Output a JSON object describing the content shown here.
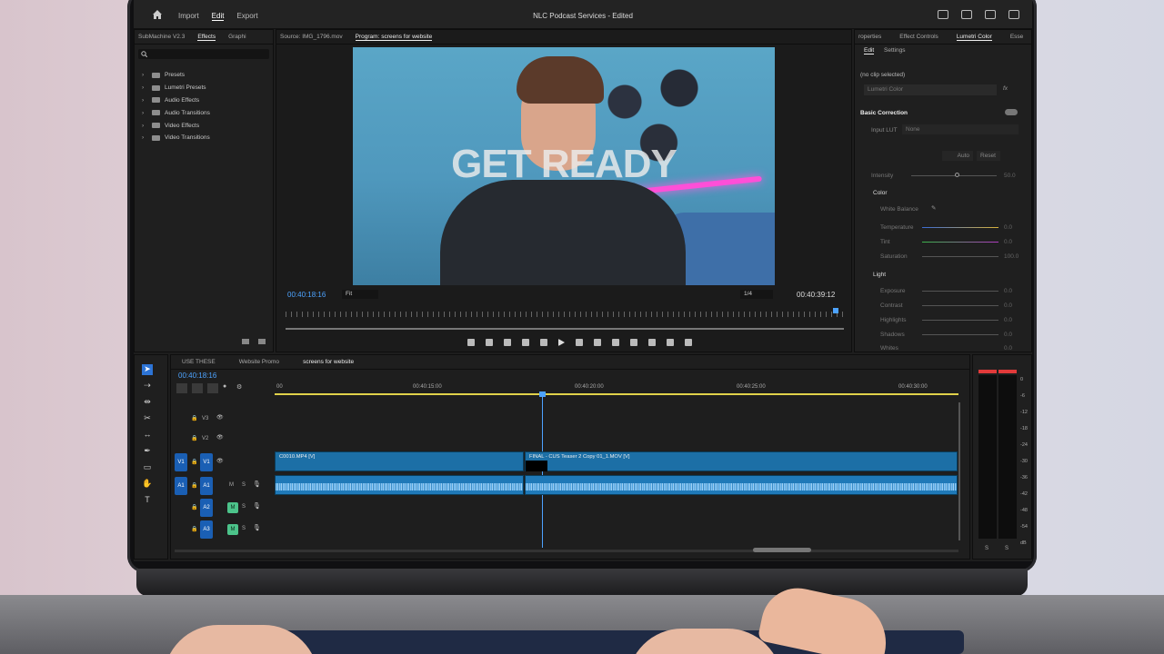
{
  "app": {
    "title": "NLC Podcast Services - Edited",
    "menu": [
      "Import",
      "Edit",
      "Export"
    ],
    "active_menu": "Edit"
  },
  "effects_panel": {
    "tabs": [
      "SubMachine V2.3",
      "Effects",
      "Graphi"
    ],
    "active_tab": "Effects",
    "items": [
      "Presets",
      "Lumetri Presets",
      "Audio Effects",
      "Audio Transitions",
      "Video Effects",
      "Video Transitions"
    ]
  },
  "monitor": {
    "tabs": [
      "Source: IMG_1796.mov",
      "Program: screens for website"
    ],
    "active_tab": "Program: screens for website",
    "overlay_text": "GET READY",
    "timecode_left": "00:40:18:16",
    "timecode_right": "00:40:39:12",
    "fit": "Fit",
    "resolution": "1/4"
  },
  "lumetri": {
    "tabs": [
      "roperties",
      "Effect Controls",
      "Lumetri Color",
      "Esse"
    ],
    "active_tab": "Lumetri Color",
    "subtabs": [
      "Edit",
      "Settings"
    ],
    "no_clip": "(no clip selected)",
    "dropdown": "Lumetri Color",
    "basic_correction": "Basic Correction",
    "input_lut_label": "Input LUT",
    "input_lut_value": "None",
    "auto": "Auto",
    "reset": "Reset",
    "intensity_label": "Intensity",
    "intensity_value": "50.0",
    "color_section": "Color",
    "white_balance": "White Balance",
    "color_rows": [
      {
        "label": "Temperature",
        "value": "0.0"
      },
      {
        "label": "Tint",
        "value": "0.0"
      },
      {
        "label": "Saturation",
        "value": "100.0"
      }
    ],
    "light_section": "Light",
    "light_rows": [
      {
        "label": "Exposure",
        "value": "0.0"
      },
      {
        "label": "Contrast",
        "value": "0.0"
      },
      {
        "label": "Highlights",
        "value": "0.0"
      },
      {
        "label": "Shadows",
        "value": "0.0"
      },
      {
        "label": "Whites",
        "value": "0.0"
      }
    ]
  },
  "timeline": {
    "tabs": [
      "USE THESE",
      "Website Promo",
      "screens for website"
    ],
    "active_tab": "screens for website",
    "timecode": "00:40:18:16",
    "ruler": [
      "00",
      "00:40:15:00",
      "00:40:20:00",
      "00:40:25:00",
      "00:40:30:00"
    ],
    "tracks": {
      "v3": "V3",
      "v2": "V2",
      "v1": "V1",
      "a1": "A1",
      "a2": "A2",
      "a3": "A3",
      "src_v1": "V1",
      "src_a1": "A1"
    },
    "clips": {
      "v1_a": "C0010.MP4 [V]",
      "v1_b": "FINAL - CUS Teaser 2 Copy 01_1.MOV [V]"
    },
    "meter_scale": [
      "0",
      "-6",
      "-12",
      "-18",
      "-24",
      "-30",
      "-36",
      "-42",
      "-48",
      "-54",
      "dB"
    ],
    "meter_solo": [
      "S",
      "S"
    ]
  }
}
